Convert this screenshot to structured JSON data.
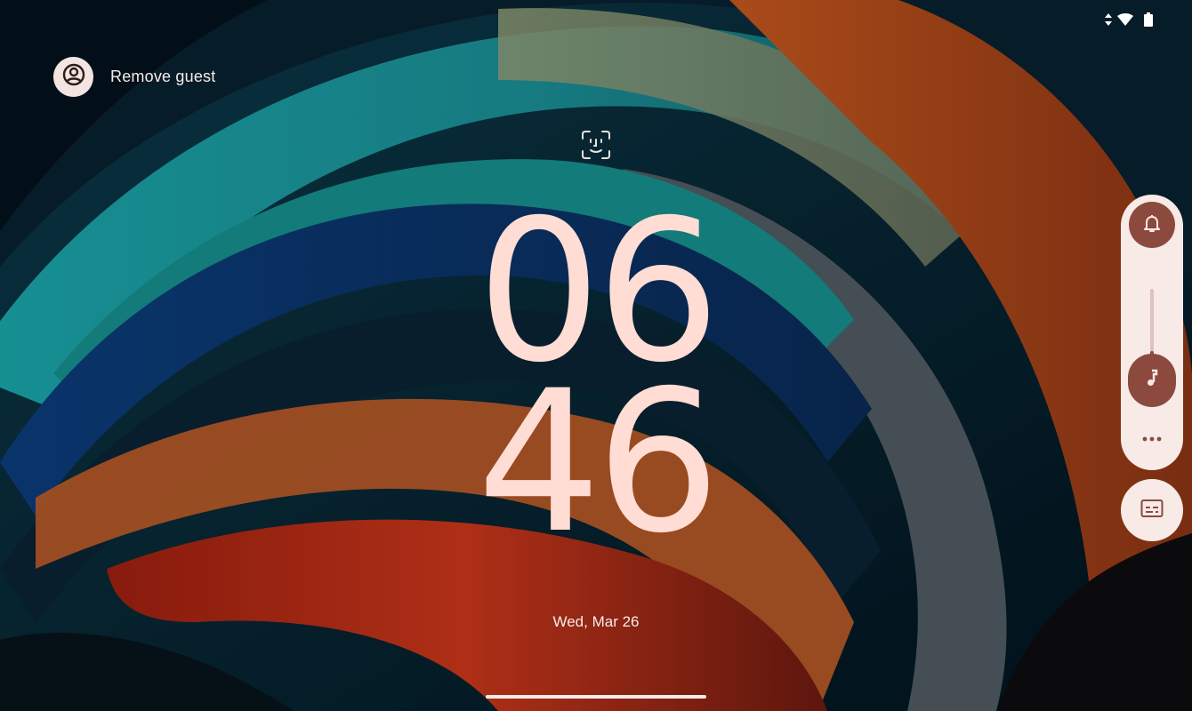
{
  "guest": {
    "label": "Remove guest"
  },
  "clock": {
    "hours": "06",
    "minutes": "46"
  },
  "date": "Wed, Mar 26",
  "volume": {
    "level": 0.3
  },
  "icons": {
    "user": "account-circle-icon",
    "face_unlock": "face-unlock-icon",
    "ringer": "bell-icon",
    "media": "music-note-icon",
    "more": "more-horizontal-icon",
    "captions": "subtitles-icon",
    "data": "mobile-data-arrows-icon",
    "wifi": "wifi-icon",
    "battery": "battery-icon"
  },
  "colors": {
    "clock": "#ffdcd4",
    "panel": "#f7eae7",
    "accent": "#8c4a3e"
  }
}
